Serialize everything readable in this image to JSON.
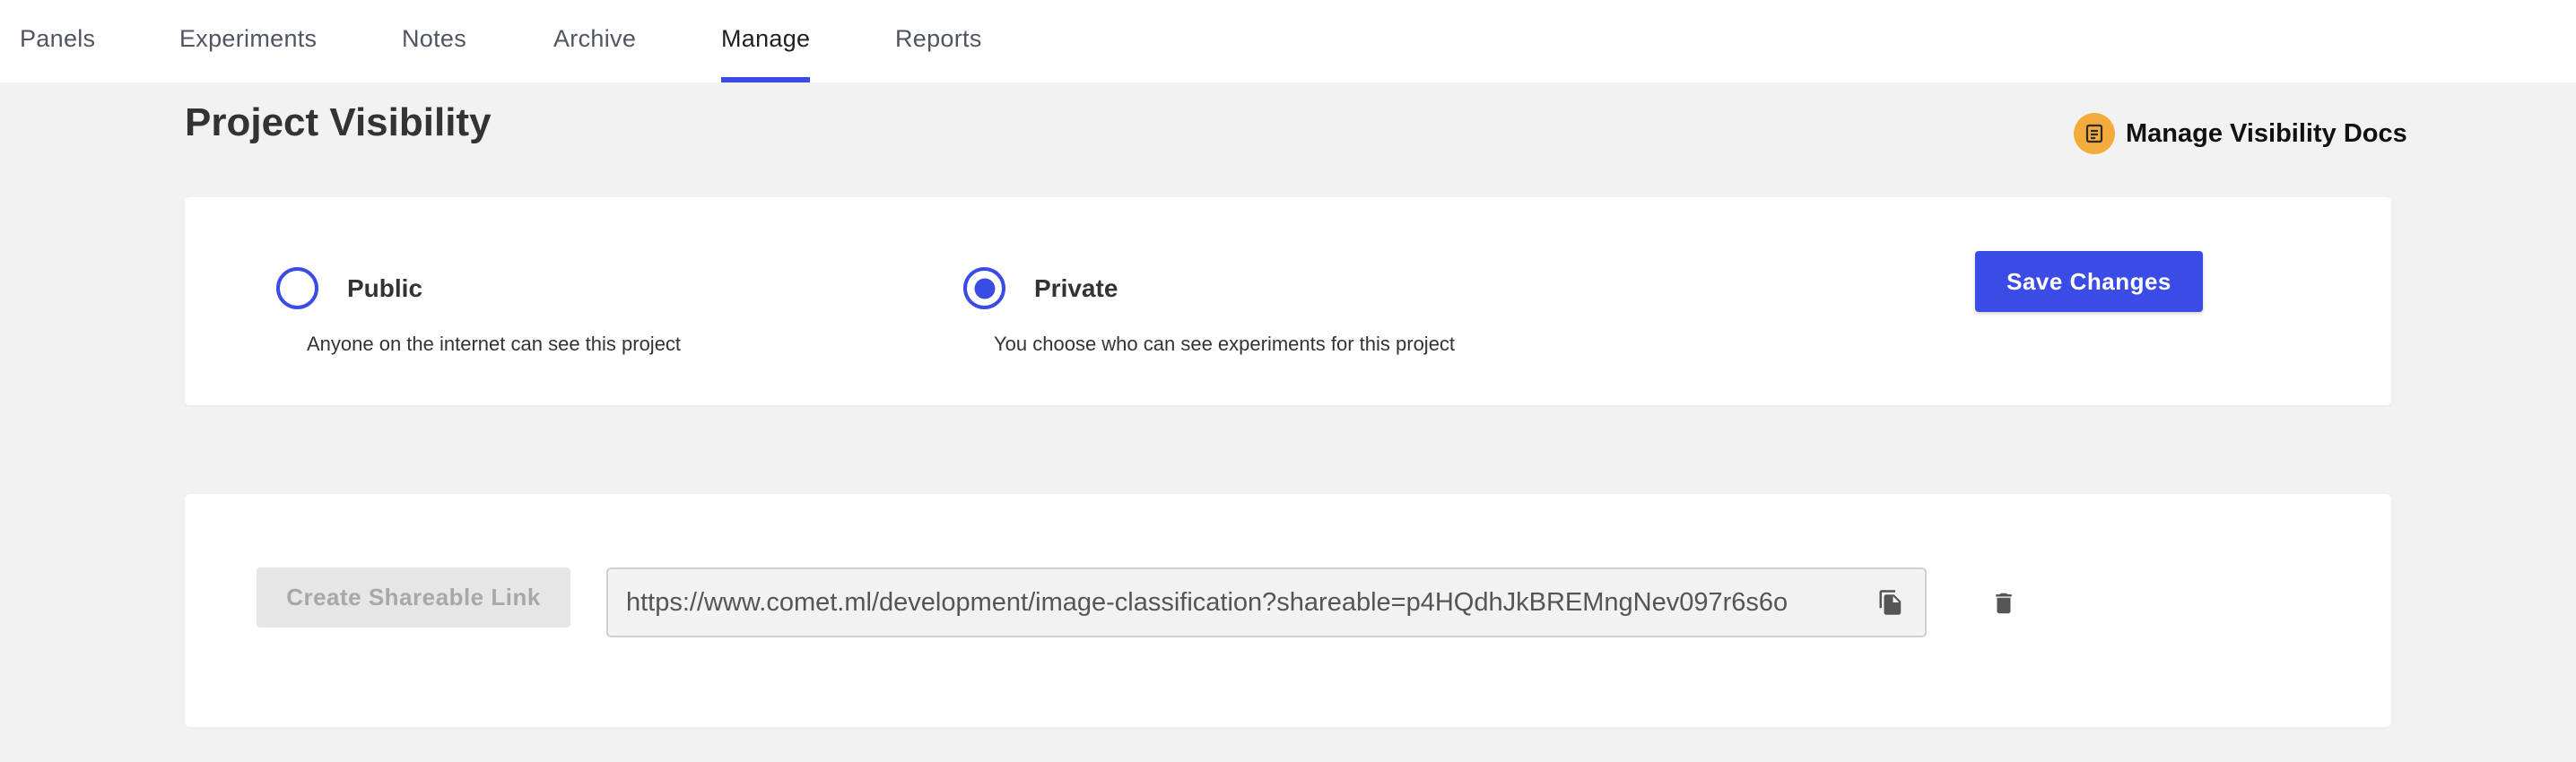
{
  "nav": {
    "tabs": [
      {
        "label": "Panels",
        "active": false
      },
      {
        "label": "Experiments",
        "active": false
      },
      {
        "label": "Notes",
        "active": false
      },
      {
        "label": "Archive",
        "active": false
      },
      {
        "label": "Manage",
        "active": true
      },
      {
        "label": "Reports",
        "active": false
      }
    ]
  },
  "header": {
    "title": "Project Visibility",
    "docs_label": "Manage Visibility Docs",
    "docs_icon": "document-icon"
  },
  "visibility": {
    "options": [
      {
        "label": "Public",
        "description": "Anyone on the internet can see this project",
        "selected": false
      },
      {
        "label": "Private",
        "description": "You choose who can see experiments for this project",
        "selected": true
      }
    ],
    "save_label": "Save Changes"
  },
  "share": {
    "button_label": "Create Shareable Link",
    "button_disabled": true,
    "link_value": "https://www.comet.ml/development/image-classification?shareable=p4HQdhJkBREMngNev097r6s6o",
    "copy_icon": "copy-icon",
    "delete_icon": "trash-icon"
  },
  "colors": {
    "accent": "#3b4be6",
    "docs_icon_bg": "#f3ab3c",
    "background": "#f2f2f2"
  }
}
